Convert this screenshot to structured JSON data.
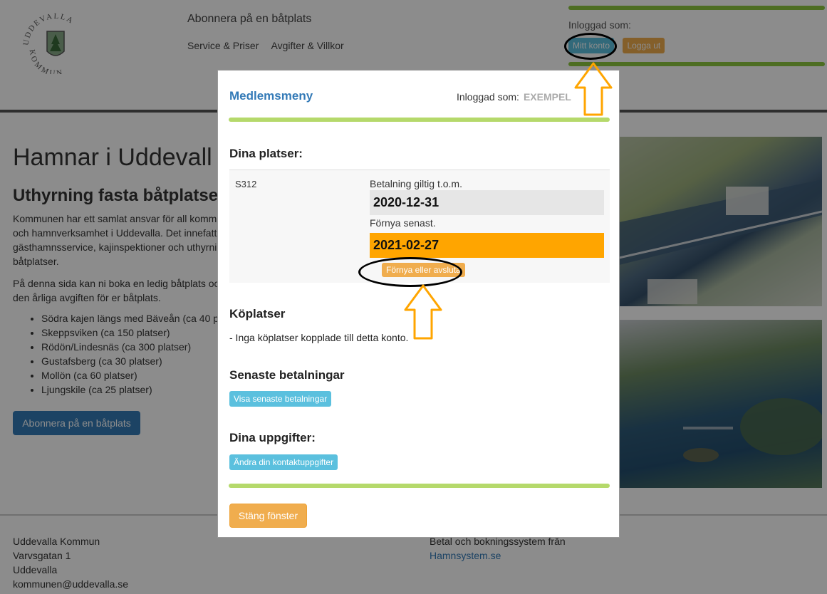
{
  "header": {
    "logo_text": "UDDEVALLA KOMMUN",
    "nav_title": "Abonnera på en båtplats",
    "nav_links": [
      "Service & Priser",
      "Avgifter & Villkor"
    ],
    "logged_in_label": "Inloggad som:",
    "username": "EXEMPEL",
    "my_account_button": "Mitt konto",
    "logout_button": "Logga ut"
  },
  "main": {
    "title": "Hamnar i Uddevall",
    "subtitle": "Uthyrning fasta båtplatser",
    "intro_lines": [
      "Kommunen har ett samlat ansvar för all kommun",
      "och hamnverksamhet i Uddevalla. Det innefatt",
      "gästhamnsservice, kajinspektioner och uthyrni",
      "båtplatser.",
      "På denna sida kan ni boka en ledig båtplats oc",
      "den årliga avgiften för er båtplats."
    ],
    "places": [
      "Södra kajen längs med Bäveån (ca 40 p",
      "Skeppsviken (ca 150 platser)",
      "Rödön/Lindesnäs (ca 300 platser)",
      "Gustafsberg (ca 30 platser)",
      "Mollön (ca 60 platser)",
      "Ljungskile (ca 25 platser)"
    ],
    "subscribe_button": "Abonnera på en båtplats"
  },
  "footer": {
    "left": [
      "Uddevalla Kommun",
      "Varvsgatan 1",
      "Uddevalla",
      "kommunen@uddevalla.se"
    ],
    "right_text": "Betal och bokningssystem från",
    "right_link": "Hamnsystem.se"
  },
  "modal": {
    "title": "Medlemsmeny",
    "logged_in_label": "Inloggad som:",
    "username": "EXEMPEL",
    "your_places_heading": "Dina platser:",
    "place_id": "S312",
    "payment_valid_label": "Betalning giltig t.o.m.",
    "payment_valid_date": "2020-12-31",
    "renew_latest_label": "Förnya senast.",
    "renew_latest_date": "2021-02-27",
    "renew_button": "Förnya eller avsluta",
    "queue_heading": "Köplatser",
    "queue_text": "- Inga köplatser kopplade till detta konto.",
    "payments_heading": "Senaste betalningar",
    "payments_button": "Visa senaste betalningar",
    "details_heading": "Dina uppgifter:",
    "details_button": "Ändra din kontaktuppgifter",
    "close_button": "Stäng fönster"
  },
  "colors": {
    "accent_blue": "#337ab7",
    "info_button": "#5bc0de",
    "warning_button": "#f0ad4e",
    "renew_highlight": "#ffa500",
    "divider_green": "#b5d96b",
    "annotation_arrow": "#ffa500"
  }
}
